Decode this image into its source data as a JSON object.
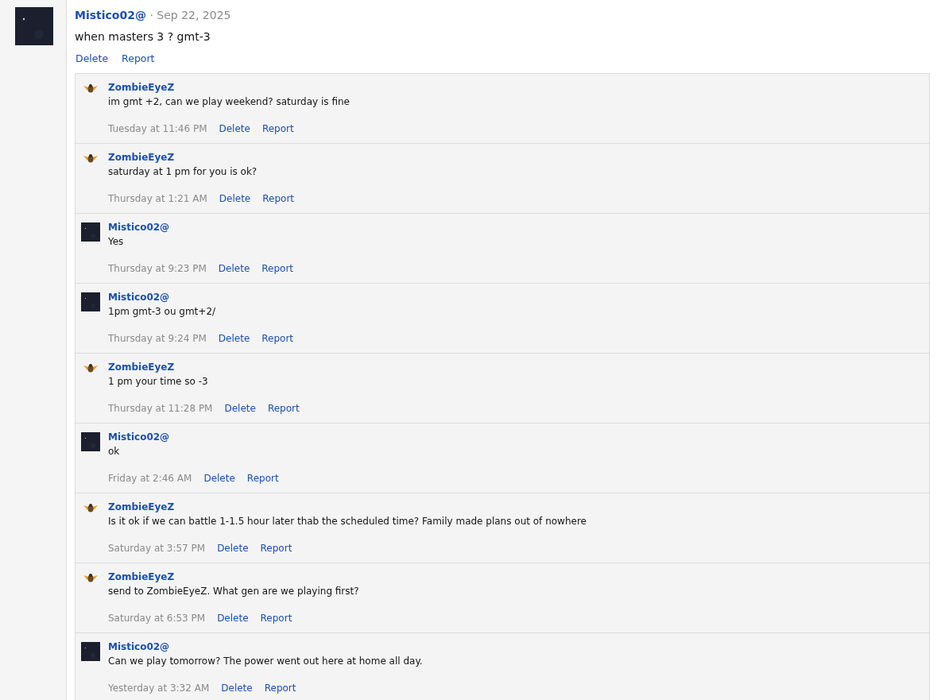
{
  "post": {
    "author": "Mistico02@",
    "kind": "photo",
    "date": "· Sep 22, 2025",
    "text": "when masters 3 ? gmt-3",
    "actions": [
      "Delete",
      "Report"
    ]
  },
  "comments": [
    {
      "author": "ZombieEyeZ",
      "kind": "sprite",
      "text": "im gmt +2, can we play weekend? saturday is fine",
      "time": "Tuesday at 11:46 PM",
      "actions": [
        "Delete",
        "Report"
      ]
    },
    {
      "author": "ZombieEyeZ",
      "kind": "sprite",
      "text": "saturday at 1 pm for you is ok?",
      "time": "Thursday at 1:21 AM",
      "actions": [
        "Delete",
        "Report"
      ]
    },
    {
      "author": "Mistico02@",
      "kind": "photo",
      "text": "Yes",
      "time": "Thursday at 9:23 PM",
      "actions": [
        "Delete",
        "Report"
      ]
    },
    {
      "author": "Mistico02@",
      "kind": "photo",
      "text": "1pm gmt-3 ou gmt+2/",
      "time": "Thursday at 9:24 PM",
      "actions": [
        "Delete",
        "Report"
      ]
    },
    {
      "author": "ZombieEyeZ",
      "kind": "sprite",
      "text": "1 pm your time so -3",
      "time": "Thursday at 11:28 PM",
      "actions": [
        "Delete",
        "Report"
      ]
    },
    {
      "author": "Mistico02@",
      "kind": "photo",
      "text": "ok",
      "time": "Friday at 2:46 AM",
      "actions": [
        "Delete",
        "Report"
      ]
    },
    {
      "author": "ZombieEyeZ",
      "kind": "sprite",
      "text": "Is it ok if we can battle 1-1.5 hour later thab the scheduled time? Family made plans out of nowhere",
      "time": "Saturday at 3:57 PM",
      "actions": [
        "Delete",
        "Report"
      ]
    },
    {
      "author": "ZombieEyeZ",
      "kind": "sprite",
      "text": "send to ZombieEyeZ. What gen are we playing first?",
      "time": "Saturday at 6:53 PM",
      "actions": [
        "Delete",
        "Report"
      ]
    },
    {
      "author": "Mistico02@",
      "kind": "photo",
      "text": "Can we play tomorrow? The power went out here at home all day.",
      "time": "Yesterday at 3:32 AM",
      "actions": [
        "Delete",
        "Report"
      ]
    }
  ]
}
